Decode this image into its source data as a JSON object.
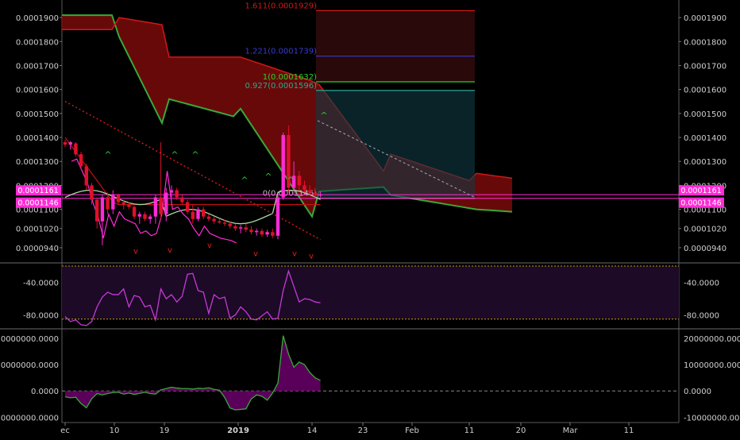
{
  "chart_data": {
    "type": "candlestick",
    "colors": {
      "background": "#000000",
      "bull": "#ff2bd6",
      "bear": "#e0102a",
      "cloud_bear": "#7a0a0a",
      "cloud_bull_line": "#3aa83a",
      "cloud_bear_line": "#d01818",
      "rsi_line": "#c63ad6",
      "label_box": "#ff2bd6",
      "tick_text": "#d0d0d0",
      "level_line": "#b8a500"
    },
    "price_axis": {
      "ticks": [
        "0.0001900",
        "0.0001800",
        "0.0001700",
        "0.0001600",
        "0.0001500",
        "0.0001400",
        "0.0001300",
        "0.0001200",
        "0.0001100",
        "0.0001020",
        "0.0000940"
      ],
      "range": [
        8.8e-05,
        0.000196
      ]
    },
    "x_axis": {
      "ticks": [
        "ec",
        "10",
        "19",
        "2019",
        "14",
        "23",
        "Feb",
        "11",
        "20",
        "Mar",
        "11"
      ]
    },
    "price_labels": [
      {
        "value": 0.0001161,
        "text": "0.0001161"
      },
      {
        "value": 0.0001146,
        "text": "0.0001146"
      }
    ],
    "fib_levels": [
      {
        "text": "1.611(0.0001929)",
        "value": 0.0001929,
        "color": "#d01818"
      },
      {
        "text": "1.221(0.0001739)",
        "value": 0.0001739,
        "color": "#3a3ad0"
      },
      {
        "text": "1(0.0001632)",
        "value": 0.0001632,
        "color": "#2ad22a"
      },
      {
        "text": "0.927(0.0001596)",
        "value": 0.0001596,
        "color": "#2aa890"
      },
      {
        "text": "0(0.0001146)",
        "value": 0.0001146,
        "color": "#bbbbbb"
      }
    ],
    "candles": [
      [
        0.000138,
        0.000139,
        0.000136,
        0.000137
      ],
      [
        0.000137,
        0.0001385,
        0.000135,
        0.000138
      ],
      [
        0.0001375,
        0.000138,
        0.000132,
        0.000133
      ],
      [
        0.000133,
        0.000134,
        0.000127,
        0.000128
      ],
      [
        0.000128,
        0.000129,
        0.000118,
        0.00012
      ],
      [
        0.00012,
        0.000121,
        0.000112,
        0.000114
      ],
      [
        0.000114,
        0.000115,
        0.000102,
        0.000105
      ],
      [
        0.000105,
        0.000116,
        9.5e-05,
        0.000115
      ],
      [
        0.000115,
        0.000117,
        0.000108,
        0.00011
      ],
      [
        0.00011,
        0.000118,
        0.000108,
        0.000116
      ],
      [
        0.000116,
        0.0001165,
        0.000112,
        0.000113
      ],
      [
        0.000113,
        0.000114,
        0.00011,
        0.000112
      ],
      [
        0.000112,
        0.000113,
        0.00011,
        0.000111
      ],
      [
        0.000111,
        0.0001115,
        0.000106,
        0.000107
      ],
      [
        0.000107,
        0.000109,
        0.000104,
        0.000108
      ],
      [
        0.000108,
        0.000109,
        0.000105,
        0.000106
      ],
      [
        0.000106,
        0.000108,
        0.000104,
        0.000107
      ],
      [
        0.000107,
        0.000116,
        0.000104,
        0.000115
      ],
      [
        0.000115,
        0.000138,
        0.000106,
        0.000108
      ],
      [
        0.000108,
        0.000119,
        0.000105,
        0.000117
      ],
      [
        0.000117,
        0.00012,
        0.000115,
        0.000118
      ],
      [
        0.000118,
        0.000119,
        0.000114,
        0.000115
      ],
      [
        0.000115,
        0.000116,
        0.000112,
        0.000113
      ],
      [
        0.000113,
        0.000114,
        0.000108,
        0.000109
      ],
      [
        0.000109,
        0.000112,
        0.000104,
        0.000106
      ],
      [
        0.000106,
        0.000111,
        0.000105,
        0.00011
      ],
      [
        0.00011,
        0.000111,
        0.000106,
        0.000107
      ],
      [
        0.000107,
        0.000108,
        0.000105,
        0.000106
      ],
      [
        0.000106,
        0.000107,
        0.000104,
        0.000105
      ],
      [
        0.000105,
        0.000106,
        0.000104,
        0.0001045
      ],
      [
        0.0001045,
        0.0001055,
        0.000103,
        0.000104
      ],
      [
        0.000104,
        0.000105,
        0.000102,
        0.000103
      ],
      [
        0.000103,
        0.000104,
        0.000101,
        0.000102
      ],
      [
        0.000102,
        0.0001035,
        0.0001,
        0.0001025
      ],
      [
        0.0001025,
        0.000104,
        0.0001005,
        0.0001015
      ],
      [
        0.0001015,
        0.000103,
        9.95e-05,
        0.0001005
      ],
      [
        0.0001005,
        0.000102,
        9.9e-05,
        0.000101
      ],
      [
        0.000101,
        0.000102,
        9.85e-05,
        9.95e-05
      ],
      [
        9.95e-05,
        0.0001015,
        9.85e-05,
        0.0001005
      ],
      [
        0.0001005,
        0.000102,
        9.8e-05,
        9.9e-05
      ],
      [
        9.9e-05,
        0.000116,
        9.75e-05,
        0.000115
      ],
      [
        0.000115,
        0.000142,
        0.000114,
        0.000141
      ],
      [
        0.000141,
        0.000145,
        0.000117,
        0.000119
      ],
      [
        0.000119,
        0.00013,
        0.000116,
        0.000124
      ],
      [
        0.000124,
        0.000126,
        0.000118,
        0.00012
      ],
      [
        0.00012,
        0.000122,
        0.000117,
        0.000118
      ],
      [
        0.000118,
        0.00012,
        0.000116,
        0.000117
      ],
      [
        0.000117,
        0.000119,
        0.000115,
        0.000116
      ],
      [
        0.000116,
        0.0001175,
        0.000115,
        0.0001161
      ]
    ],
    "rsi": {
      "ticks": [
        "-40.0000",
        "-80.0000"
      ],
      "range": [
        -95,
        -18
      ],
      "upper": -20,
      "lower": -85,
      "values": [
        -82,
        -88,
        -86,
        -92,
        -93,
        -88,
        -70,
        -58,
        -52,
        -55,
        -55,
        -48,
        -70,
        -56,
        -58,
        -70,
        -68,
        -86,
        -48,
        -60,
        -55,
        -64,
        -57,
        -30,
        -29,
        -50,
        -52,
        -78,
        -55,
        -60,
        -58,
        -84,
        -80,
        -70,
        -76,
        -85,
        -86,
        -81,
        -76,
        -85,
        -84,
        -50,
        -26,
        -45,
        -64,
        -60,
        -61,
        -64,
        -65
      ]
    },
    "volume": {
      "ticks": [
        "20000000.0000",
        "10000000.0000",
        "0.0000",
        "-10000000.0000"
      ],
      "range": [
        -12000000,
        23000000
      ],
      "values": [
        -2200000,
        -2600000,
        -2400000,
        -4800000,
        -6400000,
        -3000000,
        -1000000,
        -1500000,
        -1000000,
        -600000,
        -500000,
        -1200000,
        -800000,
        -1300000,
        -900000,
        -500000,
        -1000000,
        -1200000,
        400000,
        900000,
        1400000,
        1100000,
        900000,
        900000,
        700000,
        1000000,
        900000,
        1200000,
        600000,
        300000,
        -2500000,
        -6500000,
        -7200000,
        -7000000,
        -6800000,
        -3000000,
        -1500000,
        -2000000,
        -3500000,
        -800000,
        3000000,
        21000000,
        14000000,
        9000000,
        11000000,
        10000000,
        7000000,
        5000000,
        4000000
      ]
    }
  }
}
